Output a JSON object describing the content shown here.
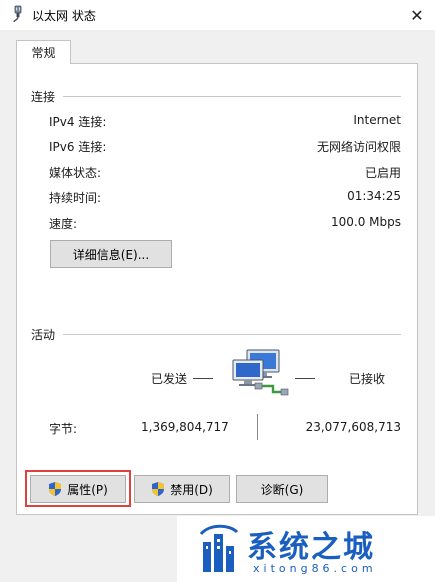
{
  "window": {
    "title": "以太网 状态",
    "close_label": "✕",
    "tab_label": "常规"
  },
  "connection": {
    "group_label": "连接",
    "rows": [
      {
        "label": "IPv4 连接:",
        "value": "Internet"
      },
      {
        "label": "IPv6 连接:",
        "value": "无网络访问权限"
      },
      {
        "label": "媒体状态:",
        "value": "已启用"
      },
      {
        "label": "持续时间:",
        "value": "01:34:25"
      },
      {
        "label": "速度:",
        "value": "100.0 Mbps"
      }
    ],
    "details_button": "详细信息(E)..."
  },
  "activity": {
    "group_label": "活动",
    "sent_label": "已发送",
    "received_label": "已接收",
    "bytes_label": "字节:",
    "bytes_sent": "1,369,804,717",
    "bytes_received": "23,077,608,713"
  },
  "buttons": {
    "properties": "属性(P)",
    "disable": "禁用(D)",
    "diagnose": "诊断(G)"
  },
  "watermark": {
    "brand": "系统之城",
    "url": "xitong86.com"
  },
  "colors": {
    "highlight": "#e0403e",
    "brand": "#1a5fc0",
    "shield_blue": "#2f64c8",
    "shield_yellow": "#f2c42d"
  },
  "icons": [
    "network-cable-icon",
    "network-computers-icon",
    "uac-shield-icon",
    "close-icon",
    "city-logo-icon"
  ]
}
